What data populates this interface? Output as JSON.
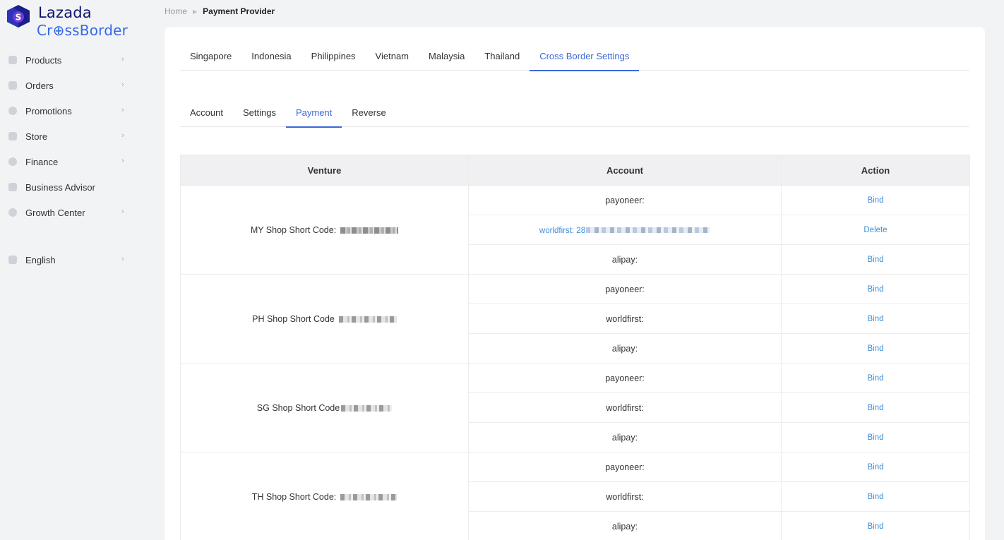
{
  "brand": {
    "name": "Lazada",
    "sub_name": "Cr⊕ssBorder",
    "colors": {
      "primary": "#0f146d",
      "accent": "#3468e8",
      "link": "#3c8ed8",
      "tab_active": "#3c68d8"
    }
  },
  "sidebar": {
    "items": [
      {
        "label": "Products",
        "icon": "box-icon",
        "chevron": "›"
      },
      {
        "label": "Orders",
        "icon": "orders-icon",
        "chevron": "›"
      },
      {
        "label": "Promotions",
        "icon": "promotion-icon",
        "chevron": "›"
      },
      {
        "label": "Store",
        "icon": "store-icon",
        "chevron": "›"
      },
      {
        "label": "Finance",
        "icon": "finance-icon",
        "chevron": "›"
      },
      {
        "label": "Business Advisor",
        "icon": "advisor-icon",
        "chevron": ""
      },
      {
        "label": "Growth Center",
        "icon": "growth-icon",
        "chevron": "›"
      }
    ],
    "language": {
      "label": "English",
      "icon": "language-icon",
      "chevron": "›"
    }
  },
  "breadcrumb": {
    "home": "Home",
    "separator": "▶",
    "current": "Payment Provider"
  },
  "country_tabs": [
    {
      "label": "Singapore",
      "active": false
    },
    {
      "label": "Indonesia",
      "active": false
    },
    {
      "label": "Philippines",
      "active": false
    },
    {
      "label": "Vietnam",
      "active": false
    },
    {
      "label": "Malaysia",
      "active": false
    },
    {
      "label": "Thailand",
      "active": false
    },
    {
      "label": "Cross Border Settings",
      "active": true
    }
  ],
  "sub_tabs": [
    {
      "label": "Account",
      "active": false
    },
    {
      "label": "Settings",
      "active": false
    },
    {
      "label": "Payment",
      "active": true
    },
    {
      "label": "Reverse",
      "active": false
    }
  ],
  "table": {
    "headers": {
      "venture": "Venture",
      "account": "Account",
      "action": "Action"
    },
    "groups": [
      {
        "venture": "MY Shop Short Code:",
        "rows": [
          {
            "account": "payoneer:",
            "action": "Bind"
          },
          {
            "account": "worldfirst: 28",
            "action": "Delete"
          },
          {
            "account": "alipay:",
            "action": "Bind"
          }
        ]
      },
      {
        "venture": "PH Shop Short Code",
        "rows": [
          {
            "account": "payoneer:",
            "action": "Bind"
          },
          {
            "account": "worldfirst:",
            "action": "Bind"
          },
          {
            "account": "alipay:",
            "action": "Bind"
          }
        ]
      },
      {
        "venture": "SG Shop Short Code",
        "rows": [
          {
            "account": "payoneer:",
            "action": "Bind"
          },
          {
            "account": "worldfirst:",
            "action": "Bind"
          },
          {
            "account": "alipay:",
            "action": "Bind"
          }
        ]
      },
      {
        "venture": "TH Shop Short Code:",
        "rows": [
          {
            "account": "payoneer:",
            "action": "Bind"
          },
          {
            "account": "worldfirst:",
            "action": "Bind"
          },
          {
            "account": "alipay:",
            "action": "Bind"
          }
        ]
      }
    ]
  }
}
